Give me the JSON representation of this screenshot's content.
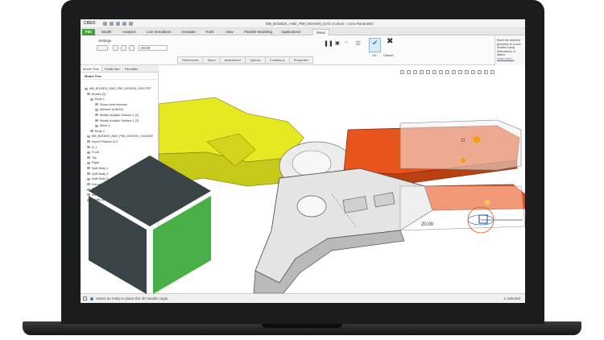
{
  "app": {
    "brand": "CREO",
    "window_title": "MB_BODIES_AND_PMI_DESIGN_CHG (Active) - Creo Parametric"
  },
  "ribbon": {
    "tabs": [
      "File",
      "Model",
      "Analysis",
      "Live Simulation",
      "Annotate",
      "Tools",
      "View",
      "Flexible Modeling",
      "Applications",
      "Move"
    ],
    "active_tab": "Move",
    "settings_label": "Settings",
    "distance_value": "20.00",
    "sub_tabs": [
      "References",
      "Steps",
      "Attachment",
      "Options",
      "Conditions",
      "Properties"
    ],
    "ok_label": "OK",
    "cancel_label": "Cancel"
  },
  "help_panel": {
    "text": "Move the selected geometry to a new location using dimensions, or attach.",
    "link": "Learn more..."
  },
  "model_tree": {
    "tabs": [
      "Model Tree",
      "Folder Bro",
      "Favorites"
    ],
    "header": "Model Tree",
    "items": [
      "MB_BODIES_AND_PMI_DESIGN_CHG.PRT",
      "Bodies (2)",
      "Body 1",
      "Show more features",
      "Member id 56224",
      "Modify Analytic Surface 1 [2]",
      "Modify Analytic Surface 1 [2]",
      "Move 4",
      "Body 2",
      "MB_BODIES_AND_PMI_DESIGN_CHANGE",
      "Import Feature id 3",
      "A_1",
      "Front",
      "Top",
      "Right",
      "Split Body 1",
      "Split Body 2",
      "Split Body 3",
      "Extrude 1",
      "Round 1",
      "Move 3",
      "Modify Analytic Surface"
    ]
  },
  "viewport": {
    "dimension_label": "20.00"
  },
  "status_bar": {
    "message": "Select an entity to place the 3D handle origin.",
    "selection": "1 selected"
  },
  "colors": {
    "file_tab": "#3fa535",
    "part_yellow": "#e6e822",
    "part_orange": "#e8541b",
    "part_gray": "#e2e2e2",
    "logo_dark": "#3a4346",
    "logo_green": "#48b047"
  }
}
